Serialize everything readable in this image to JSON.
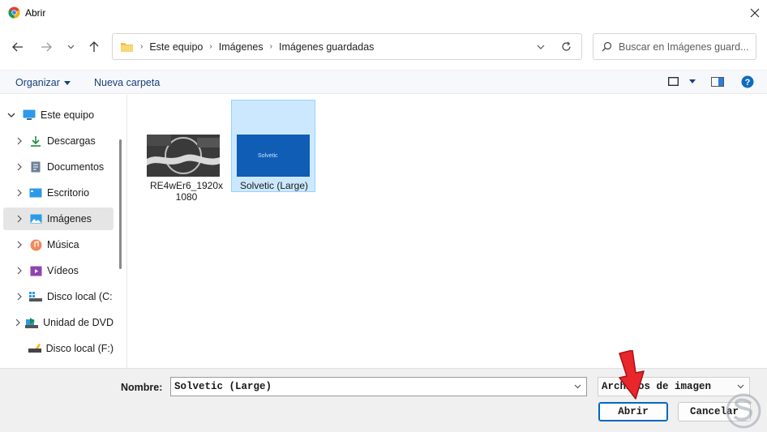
{
  "window": {
    "title": "Abrir"
  },
  "address": {
    "crumbs": [
      "Este equipo",
      "Imágenes",
      "Imágenes guardadas"
    ]
  },
  "search": {
    "placeholder": "Buscar en Imágenes guard..."
  },
  "toolbar": {
    "organize_label": "Organizar",
    "new_folder_label": "Nueva carpeta"
  },
  "sidebar": {
    "root": {
      "label": "Este equipo"
    },
    "items": [
      {
        "label": "Descargas",
        "icon": "download-icon"
      },
      {
        "label": "Documentos",
        "icon": "documents-icon"
      },
      {
        "label": "Escritorio",
        "icon": "desktop-icon"
      },
      {
        "label": "Imágenes",
        "icon": "pictures-icon",
        "selected": true
      },
      {
        "label": "Música",
        "icon": "music-icon"
      },
      {
        "label": "Vídeos",
        "icon": "videos-icon"
      },
      {
        "label": "Disco local (C:",
        "icon": "drive-icon"
      },
      {
        "label": "Unidad de DVD",
        "icon": "dvd-icon"
      },
      {
        "label": "Disco local (F:)",
        "icon": "usb-drive-icon"
      }
    ]
  },
  "files": [
    {
      "name_line1": "RE4wEr6_1920x",
      "name_line2": "1080",
      "selected": false
    },
    {
      "name_line1": "Solvetic (Large)",
      "name_line2": "",
      "selected": true,
      "thumb_text": "Solvetic"
    }
  ],
  "footer": {
    "name_label": "Nombre:",
    "name_value": "Solvetic (Large)",
    "type_value": "Archivos de imagen",
    "open_label": "Abrir",
    "cancel_label": "Cancelar"
  },
  "colors": {
    "accent": "#0067c0",
    "selection": "#cce8ff",
    "folder": "#f4c04a",
    "annotation": "#e8262b"
  }
}
